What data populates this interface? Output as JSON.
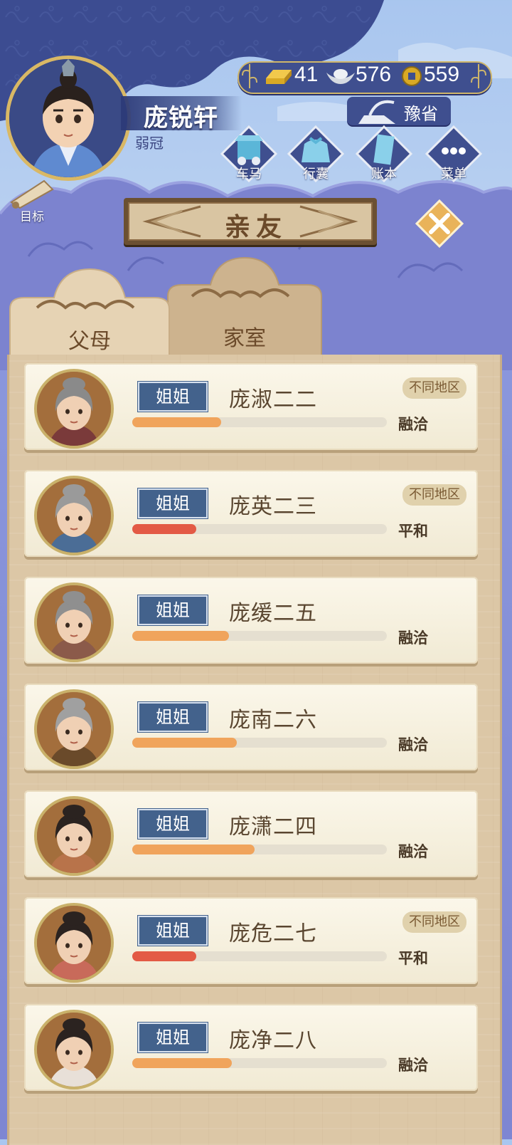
{
  "player": {
    "name": "庞锐轩",
    "age_title": "弱冠"
  },
  "currency": {
    "gold": "41",
    "silver": "576",
    "copper": "559"
  },
  "region": "豫省",
  "nav": [
    {
      "label": "车马",
      "icon": "carriage-icon"
    },
    {
      "label": "行囊",
      "icon": "bag-icon"
    },
    {
      "label": "账本",
      "icon": "ledger-icon"
    },
    {
      "label": "菜单",
      "icon": "menu-icon"
    }
  ],
  "goal": {
    "label": "目标"
  },
  "panel": {
    "title": "亲友"
  },
  "tabs": [
    {
      "label": "父母",
      "active": true
    },
    {
      "label": "家室",
      "active": false
    }
  ],
  "members": [
    {
      "relation": "姐姐",
      "name": "庞淑二二",
      "status": "融洽",
      "tag": "不同地区",
      "affinity": 0.35,
      "bar_color": "#f0a45c",
      "hair": "#8a8a8a"
    },
    {
      "relation": "姐姐",
      "name": "庞英二三",
      "status": "平和",
      "tag": "不同地区",
      "affinity": 0.25,
      "bar_color": "#e35a45",
      "hair": "#9a9a9a"
    },
    {
      "relation": "姐姐",
      "name": "庞缓二五",
      "status": "融洽",
      "tag": "",
      "affinity": 0.38,
      "bar_color": "#f0a45c",
      "hair": "#8f8f8f"
    },
    {
      "relation": "姐姐",
      "name": "庞南二六",
      "status": "融洽",
      "tag": "",
      "affinity": 0.41,
      "bar_color": "#f0a45c",
      "hair": "#a0a0a0"
    },
    {
      "relation": "姐姐",
      "name": "庞潇二四",
      "status": "融洽",
      "tag": "",
      "affinity": 0.48,
      "bar_color": "#f0a45c",
      "hair": "#2b2320"
    },
    {
      "relation": "姐姐",
      "name": "庞危二七",
      "status": "平和",
      "tag": "不同地区",
      "affinity": 0.25,
      "bar_color": "#e35a45",
      "hair": "#2b2320"
    },
    {
      "relation": "姐姐",
      "name": "庞净二八",
      "status": "融洽",
      "tag": "",
      "affinity": 0.39,
      "bar_color": "#f0a45c",
      "hair": "#2b2320"
    }
  ]
}
